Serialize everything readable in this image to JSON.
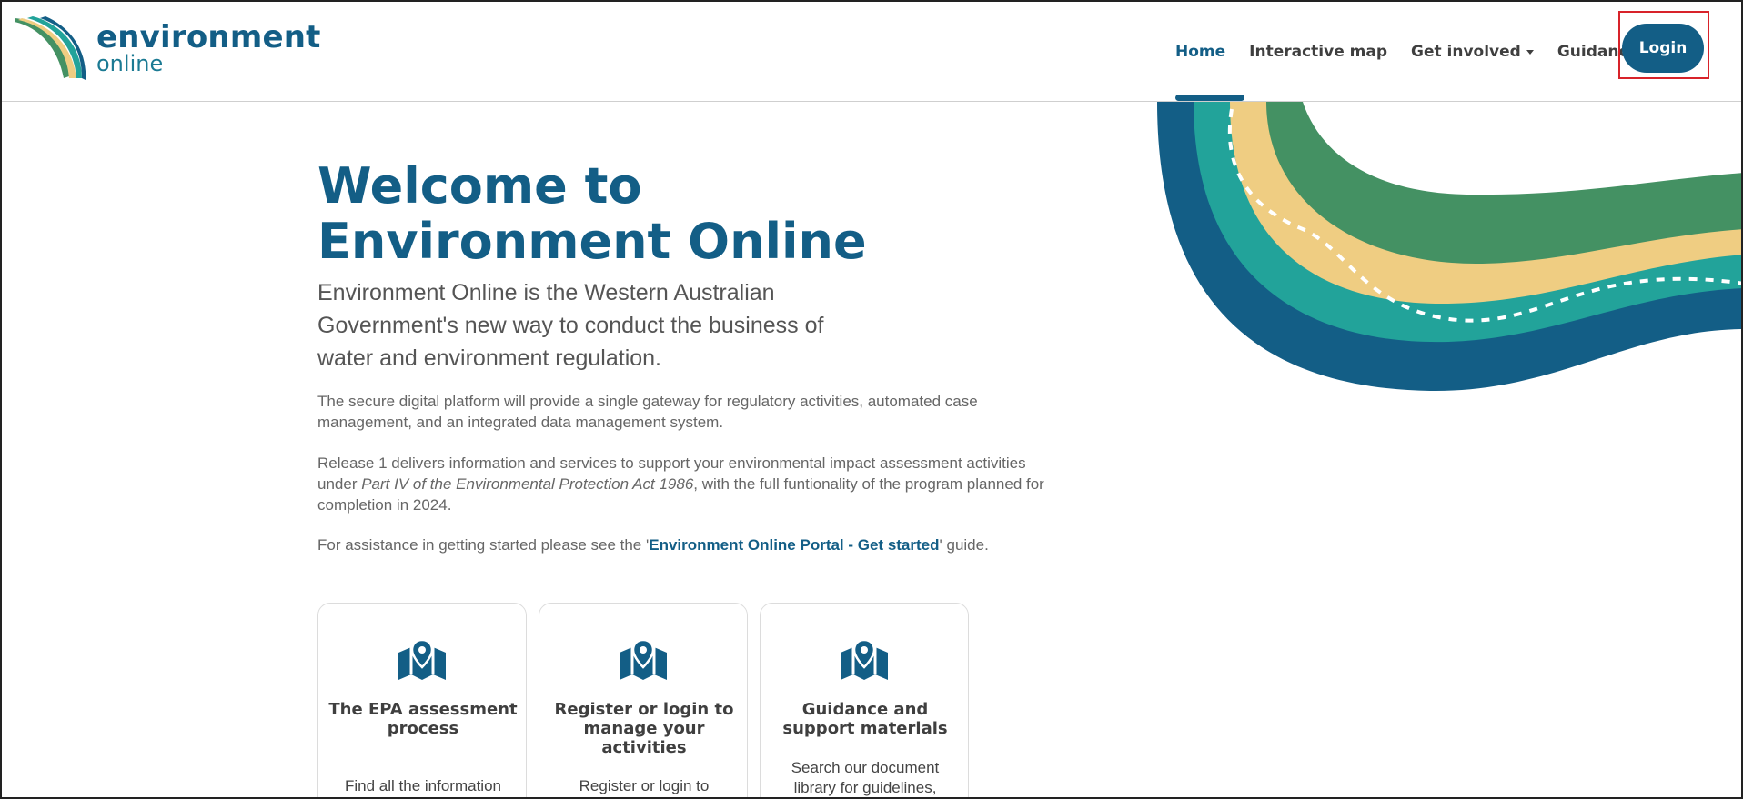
{
  "header": {
    "logo": {
      "title": "environment",
      "subtitle": "online"
    },
    "nav": [
      {
        "label": "Home",
        "active": true
      },
      {
        "label": "Interactive map"
      },
      {
        "label": "Get involved",
        "dropdown": true
      },
      {
        "label": "Guidance"
      }
    ],
    "login_label": "Login"
  },
  "hero": {
    "title_line1": "Welcome to",
    "title_line2": "Environment Online",
    "lead": "Environment Online is the Western Australian Government's new way to conduct the business of water and environment regulation.",
    "p1": "The secure digital platform will provide a single gateway for regulatory activities, automated case management, and an integrated data management system.",
    "p2_before": "Release 1 delivers information and services to support your environmental impact assessment activities under ",
    "p2_italic": "Part IV of the Environmental Protection Act 1986",
    "p2_after": ", with the full funtionality of the program planned for completion in 2024.",
    "p3_before": "For assistance in getting started please see the '",
    "p3_link": "Environment Online Portal - Get started",
    "p3_after": "' guide."
  },
  "cards": [
    {
      "title": "The EPA assessment process",
      "desc": "Find all the information",
      "icon": "map-marker-icon"
    },
    {
      "title": "Register or login to manage your activities",
      "desc": "Register or login to",
      "icon": "map-marker-icon"
    },
    {
      "title": "Guidance and support materials",
      "desc": "Search our document library for guidelines,",
      "icon": "map-marker-icon"
    }
  ],
  "colors": {
    "brand_blue": "#135e86",
    "teal": "#22a39a",
    "sand": "#efcd82",
    "green": "#449163",
    "highlight_red": "#d8232a"
  }
}
